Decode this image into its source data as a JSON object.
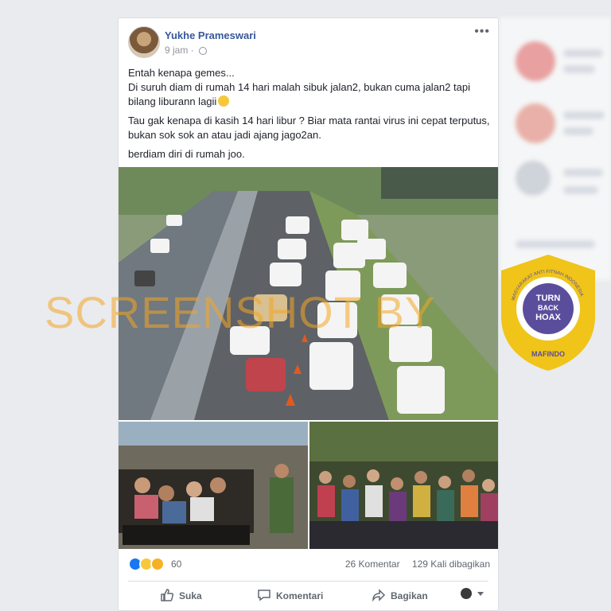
{
  "post": {
    "author": "Yukhe Prameswari",
    "time": "9 jam",
    "time_sep": "·",
    "paragraphs": [
      "Entah kenapa gemes...",
      "Di suruh diam di rumah 14 hari malah sibuk jalan2, bukan cuma jalan2 tapi bilang liburann lagii",
      "Tau gak kenapa di kasih 14 hari libur ? Biar mata rantai virus ini cepat terputus, bukan sok sok an atau jadi ajang jago2an.",
      "berdiam diri di rumah joo."
    ],
    "reaction_count": "60",
    "comments": "26 Komentar",
    "shares": "129 Kali dibagikan"
  },
  "actions": {
    "like": "Suka",
    "comment": "Komentari",
    "share": "Bagikan"
  },
  "watermark": "SCREENSHOT BY",
  "badge": {
    "line1": "TURN",
    "line2": "BACK",
    "line3": "HOAX",
    "ring_text": "MASYARAKAT ANTI FITNAH INDONESIA",
    "org": "MAFINDO"
  },
  "colors": {
    "link": "#385898",
    "like_blue": "#1877f2",
    "haha_yellow": "#f7c83c",
    "badge_yellow": "#f0c419",
    "badge_purple": "#5a4e9c",
    "watermark": "#f5a623"
  }
}
